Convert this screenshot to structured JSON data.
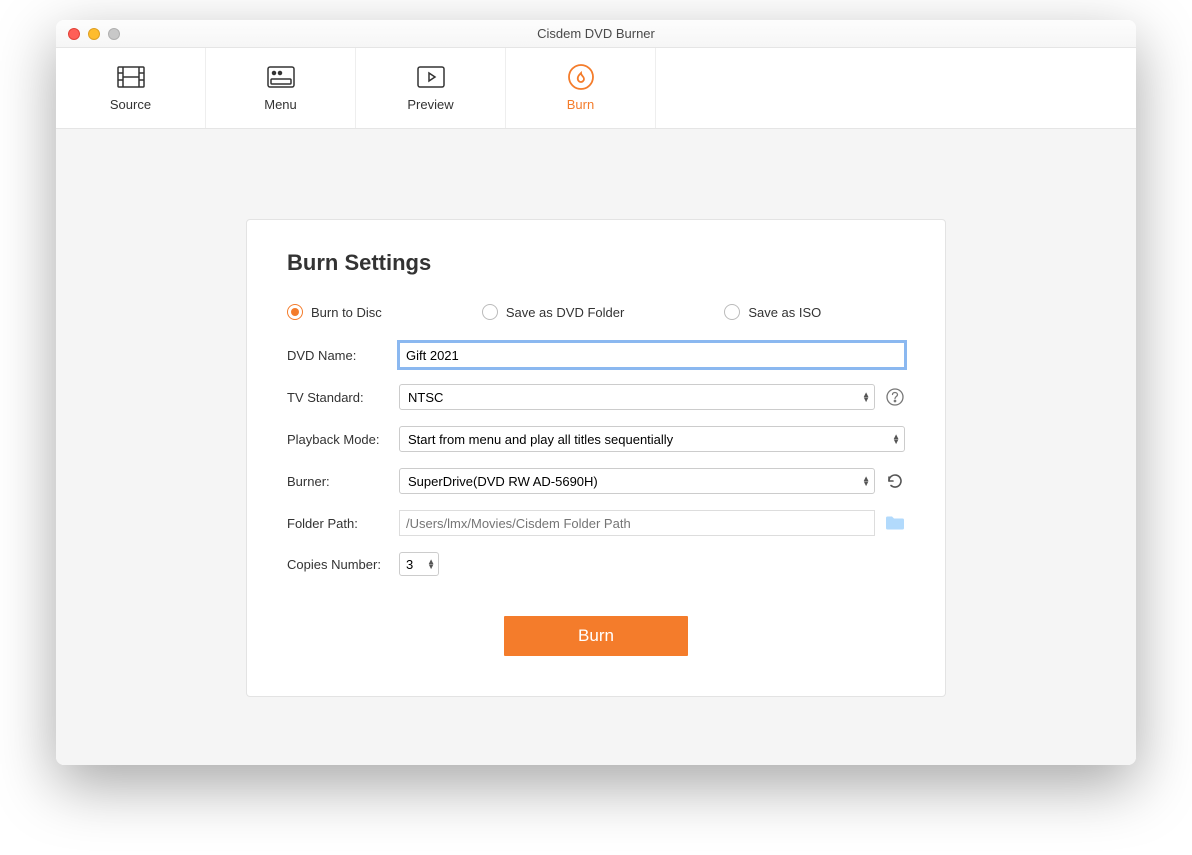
{
  "window": {
    "title": "Cisdem DVD Burner"
  },
  "tabs": [
    {
      "label": "Source",
      "icon": "film-icon",
      "active": false
    },
    {
      "label": "Menu",
      "icon": "menu-icon",
      "active": false
    },
    {
      "label": "Preview",
      "icon": "play-icon",
      "active": false
    },
    {
      "label": "Burn",
      "icon": "burn-icon",
      "active": true
    }
  ],
  "panel": {
    "title": "Burn Settings",
    "output_options": [
      {
        "label": "Burn to Disc",
        "selected": true
      },
      {
        "label": "Save as DVD Folder",
        "selected": false
      },
      {
        "label": "Save as ISO",
        "selected": false
      }
    ],
    "labels": {
      "dvd_name": "DVD Name:",
      "tv_standard": "TV Standard:",
      "playback_mode": "Playback Mode:",
      "burner": "Burner:",
      "folder_path": "Folder Path:",
      "copies_number": "Copies Number:"
    },
    "values": {
      "dvd_name": "Gift 2021",
      "tv_standard": "NTSC",
      "playback_mode": "Start from menu and play all titles sequentially",
      "burner": "SuperDrive(DVD RW AD-5690H)",
      "folder_path_placeholder": "/Users/lmx/Movies/Cisdem Folder Path",
      "copies_number": "3"
    },
    "burn_button": "Burn"
  },
  "colors": {
    "accent": "#f47c2b"
  }
}
